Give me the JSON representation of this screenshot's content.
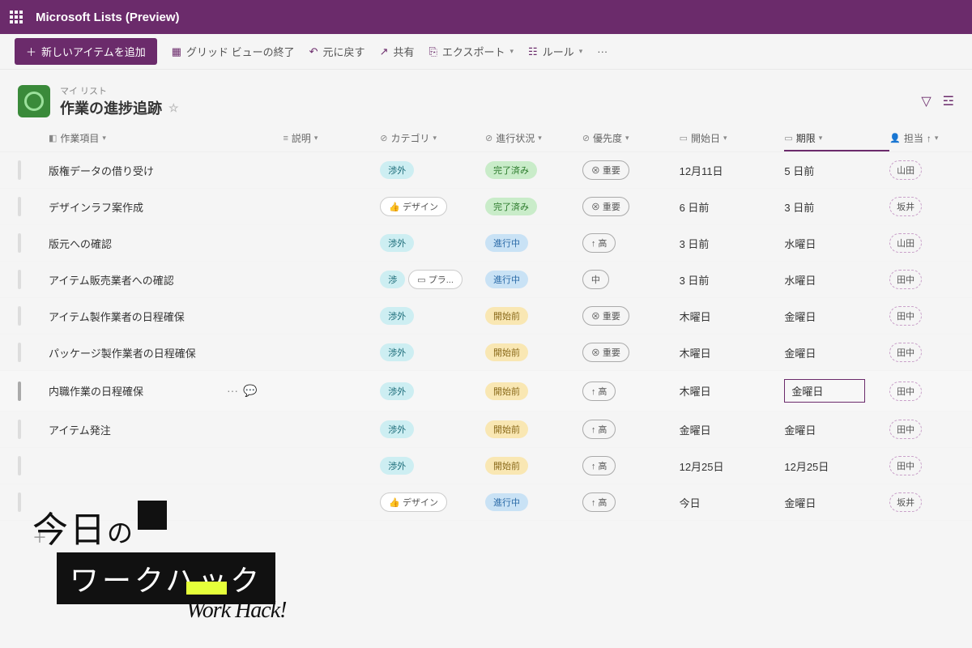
{
  "topbar": {
    "app": "Microsoft Lists (Preview)"
  },
  "commands": {
    "new_item": "新しいアイテムを追加",
    "grid_exit": "グリッド ビューの終了",
    "undo": "元に戻す",
    "share": "共有",
    "export": "エクスポート",
    "rules": "ルール"
  },
  "list": {
    "breadcrumb": "マイ リスト",
    "title": "作業の進捗追跡"
  },
  "columns": {
    "item": "作業項目",
    "desc": "説明",
    "cat": "カテゴリ",
    "status": "進行状況",
    "prio": "優先度",
    "start": "開始日",
    "due": "期限",
    "assign": "担当"
  },
  "status_labels": {
    "done": "完了済み",
    "prog": "進行中",
    "pre": "開始前"
  },
  "cat_labels": {
    "ext": "渉外",
    "design": "デザイン",
    "ext_short": "渉",
    "plan": "プラ..."
  },
  "prio_labels": {
    "critical": "⊗ 重要",
    "high": "↑ 高",
    "med": "中"
  },
  "rows": [
    {
      "item": "版権データの借り受け",
      "cats": [
        "ext"
      ],
      "status": "done",
      "prio": "critical",
      "start": "12月11日",
      "due": "5 日前",
      "assign": "山田"
    },
    {
      "item": "デザインラフ案作成",
      "cats": [
        "design"
      ],
      "status": "done",
      "prio": "critical",
      "start": "6 日前",
      "due": "3 日前",
      "assign": "坂井"
    },
    {
      "item": "版元への確認",
      "cats": [
        "ext"
      ],
      "status": "prog",
      "prio": "high",
      "start": "3 日前",
      "due": "水曜日",
      "assign": "山田"
    },
    {
      "item": "アイテム販売業者への確認",
      "cats": [
        "ext_short",
        "plan"
      ],
      "status": "prog",
      "prio": "med",
      "start": "3 日前",
      "due": "水曜日",
      "assign": "田中"
    },
    {
      "item": "アイテム製作業者の日程確保",
      "cats": [
        "ext"
      ],
      "status": "pre",
      "prio": "critical",
      "start": "木曜日",
      "due": "金曜日",
      "assign": "田中"
    },
    {
      "item": "パッケージ製作業者の日程確保",
      "cats": [
        "ext"
      ],
      "status": "pre",
      "prio": "critical",
      "start": "木曜日",
      "due": "金曜日",
      "assign": "田中"
    },
    {
      "item": "内職作業の日程確保",
      "cats": [
        "ext"
      ],
      "status": "pre",
      "prio": "high",
      "start": "木曜日",
      "due": "金曜日",
      "assign": "田中",
      "hovered": true,
      "editing_due": true
    },
    {
      "item": "アイテム発注",
      "cats": [
        "ext"
      ],
      "status": "pre",
      "prio": "high",
      "start": "金曜日",
      "due": "金曜日",
      "assign": "田中"
    },
    {
      "item": "",
      "cats": [
        "ext"
      ],
      "status": "pre",
      "prio": "high",
      "start": "12月25日",
      "due": "12月25日",
      "assign": "田中"
    },
    {
      "item": "",
      "cats": [
        "design"
      ],
      "status": "prog",
      "prio": "high",
      "start": "今日",
      "due": "金曜日",
      "assign": "坂井"
    }
  ],
  "overlay": {
    "line1_a": "今日",
    "line1_b": "の",
    "line2": "ワークハック",
    "script": "Work Hack!"
  }
}
